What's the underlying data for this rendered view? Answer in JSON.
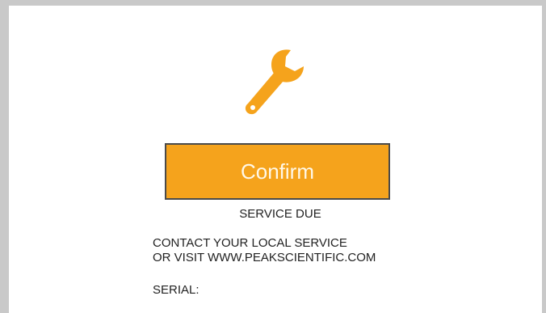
{
  "colors": {
    "accent": "#f5a31c",
    "frame": "#c9c9c9",
    "button_border": "#4a4a4a",
    "button_text": "#fff8e8"
  },
  "icon": "wrench-icon",
  "confirm_button": {
    "label": "Confirm"
  },
  "status": {
    "title": "SERVICE DUE"
  },
  "message": {
    "line1": "CONTACT YOUR LOCAL SERVICE",
    "line2": "OR VISIT WWW.PEAKSCIENTIFIC.COM"
  },
  "serial": {
    "label": "SERIAL:"
  }
}
